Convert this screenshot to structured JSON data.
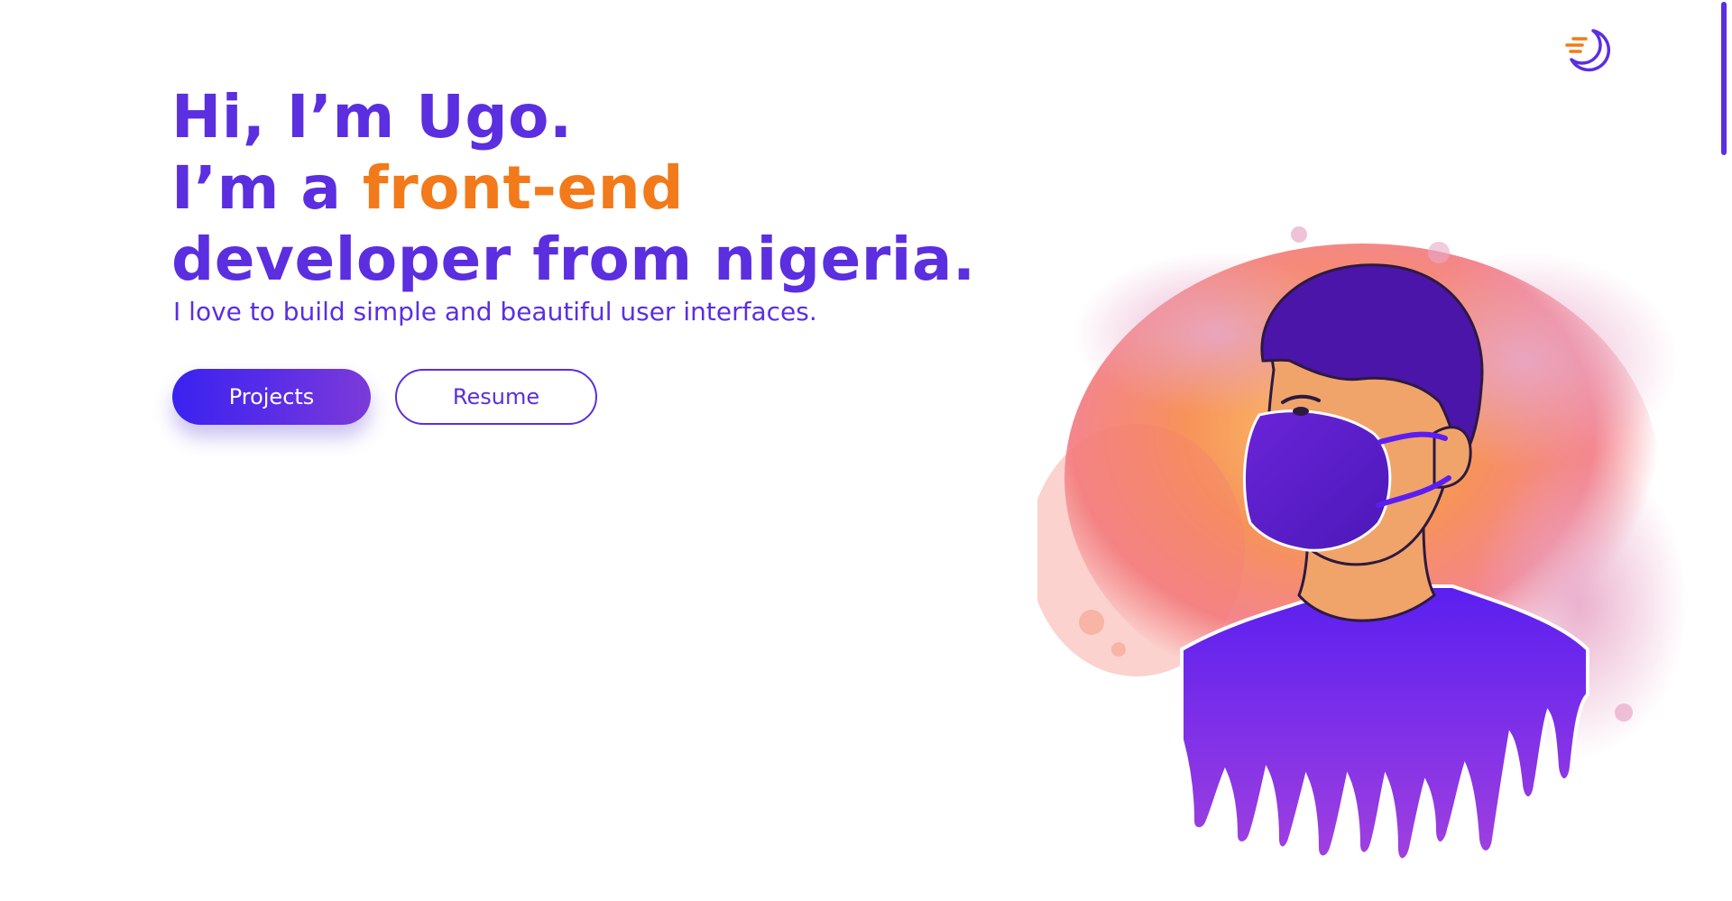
{
  "hero": {
    "greeting": "Hi, I’m Ugo.",
    "intro_prefix": "I’m a ",
    "intro_highlight": "front-end",
    "intro_suffix": "developer from nigeria.",
    "tagline": "I love to build simple and beautiful user interfaces."
  },
  "actions": {
    "projects_label": "Projects",
    "resume_label": "Resume"
  },
  "header": {
    "logo_icon": "moon-speed-logo-icon"
  },
  "illustration": {
    "icon": "masked-developer-portrait"
  },
  "colors": {
    "primary": "#5b2ee0",
    "accent": "#f27a1a",
    "background": "#ffffff"
  }
}
